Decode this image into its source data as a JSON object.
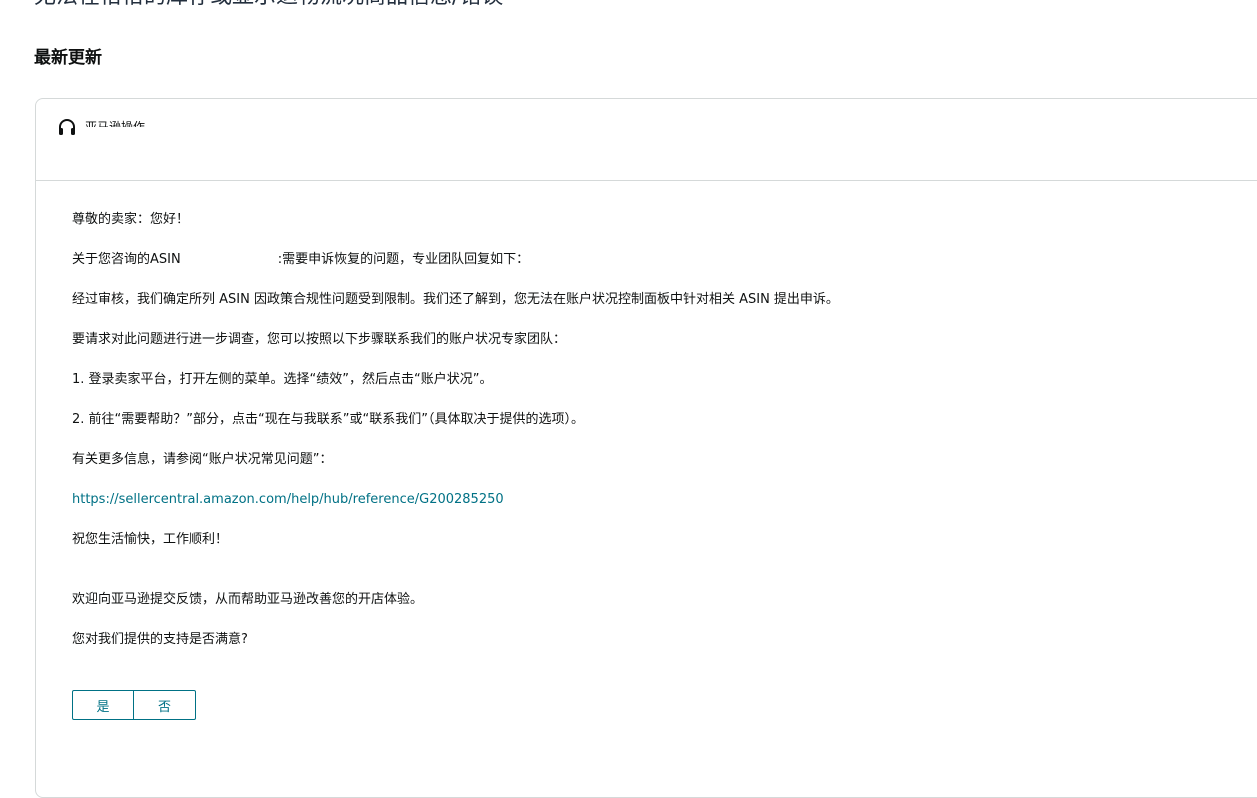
{
  "page": {
    "top_heading_partial": "无法在恰恰的库存或显示退物流况商品信息/错误"
  },
  "section": {
    "title": "最新更新"
  },
  "card": {
    "header": {
      "icon": "headset-icon",
      "label": "亚马逊操作"
    },
    "body": {
      "greeting": "尊敬的卖家：您好！",
      "asin_prefix": "关于您咨询的ASIN",
      "asin_suffix": ":需要申诉恢复的问题，专业团队回复如下：",
      "review": "经过审核，我们确定所列 ASIN 因政策合规性问题受到限制。我们还了解到，您无法在账户状况控制面板中针对相关 ASIN 提出申诉。",
      "request": "要请求对此问题进行进一步调查，您可以按照以下步骤联系我们的账户状况专家团队：",
      "step1": "1. 登录卖家平台，打开左侧的菜单。选择“绩效”，然后点击“账户状况”。",
      "step2": "2. 前往“需要帮助？”部分，点击“现在与我联系”或“联系我们”（具体取决于提供的选项）。",
      "more_info": "有关更多信息，请参阅“账户状况常见问题”：",
      "link": "https://sellercentral.amazon.com/help/hub/reference/G200285250",
      "wish": "祝您生活愉快，工作顺利！",
      "feedback": "欢迎向亚马逊提交反馈，从而帮助亚马逊改善您的开店体验。",
      "satisfaction_question": "您对我们提供的支持是否满意?"
    },
    "buttons": {
      "yes": "是",
      "no": "否"
    }
  },
  "colors": {
    "link": "#007185",
    "border": "#d5d9d9",
    "text": "#0f1111"
  }
}
